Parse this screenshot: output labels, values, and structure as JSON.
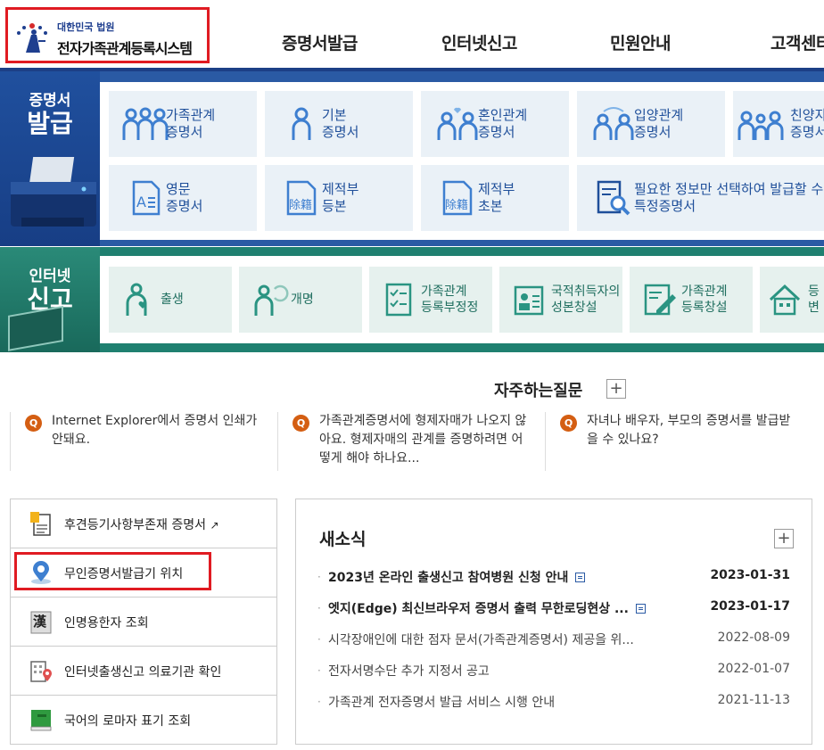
{
  "header": {
    "court": "대한민국 법원",
    "system": "전자가족관계등록시스템",
    "nav": [
      "증명서발급",
      "인터넷신고",
      "민원안내",
      "고객센터"
    ]
  },
  "issue": {
    "side_small": "증명서",
    "side_big": "발급",
    "tiles": [
      {
        "line1": "가족관계",
        "line2": "증명서",
        "icon": "family-icon"
      },
      {
        "line1": "기본",
        "line2": "증명서",
        "icon": "person-icon"
      },
      {
        "line1": "혼인관계",
        "line2": "증명서",
        "icon": "couple-icon"
      },
      {
        "line1": "입양관계",
        "line2": "증명서",
        "icon": "adoption-icon"
      },
      {
        "line1": "친양자",
        "line2": "증명서",
        "icon": "family-icon"
      },
      {
        "line1": "영문",
        "line2": "증명서",
        "icon": "english-document-icon"
      },
      {
        "line1": "제적부",
        "line2": "등본",
        "icon": "register-icon"
      },
      {
        "line1": "제적부",
        "line2": "초본",
        "icon": "register-icon"
      },
      {
        "line1": "필요한 정보만 선택하여 발급할 수",
        "line2": "특정증명서",
        "icon": "magnifier-document-icon"
      }
    ],
    "register_glyph": "除籍"
  },
  "report": {
    "side_small": "인터넷",
    "side_big": "신고",
    "tiles": [
      {
        "line1": "출생",
        "line2": "",
        "icon": "baby-icon"
      },
      {
        "line1": "개명",
        "line2": "",
        "icon": "rename-icon"
      },
      {
        "line1": "가족관계",
        "line2": "등록부정정",
        "icon": "checklist-icon"
      },
      {
        "line1": "국적취득자의",
        "line2": "성본창설",
        "icon": "id-card-icon"
      },
      {
        "line1": "가족관계",
        "line2": "등록창설",
        "icon": "form-pen-icon"
      },
      {
        "line1": "등",
        "line2": "변",
        "icon": "house-icon"
      }
    ]
  },
  "faq": {
    "title": "자주하는질문",
    "more": "+",
    "badge": "Q",
    "items": [
      "Internet Explorer에서 증명서 인쇄가 안돼요.",
      "가족관계증명서에 형제자매가 나오지 않아요. 형제자매의 관계를 증명하려면 어떻게 해야 하나요...",
      "자녀나 배우자, 부모의 증명서를 발급받을 수 있나요?"
    ]
  },
  "quick": {
    "items": [
      {
        "label": "후견등기사항부존재 증명서",
        "icon": "document-icon",
        "external": "↗"
      },
      {
        "label": "무인증명서발급기 위치",
        "icon": "location-pin-icon",
        "external": ""
      },
      {
        "label": "인명용한자 조회",
        "icon": "hanja-book-icon",
        "external": ""
      },
      {
        "label": "인터넷출생신고 의료기관 확인",
        "icon": "hospital-icon",
        "external": ""
      },
      {
        "label": "국어의 로마자 표기 조회",
        "icon": "green-book-icon",
        "external": ""
      }
    ],
    "hanja_glyph": "漢"
  },
  "news": {
    "title": "새소식",
    "more": "+",
    "items": [
      {
        "title": "2023년 온라인 출생신고 참여병원 신청 안내",
        "date": "2023-01-31",
        "bold": true,
        "doc": true
      },
      {
        "title": "엣지(Edge) 최신브라우저 증명서 출력 무한로딩현상 ...",
        "date": "2023-01-17",
        "bold": true,
        "doc": true
      },
      {
        "title": "시각장애인에 대한 점자 문서(가족관계증명서) 제공을 위...",
        "date": "2022-08-09",
        "bold": false,
        "doc": false
      },
      {
        "title": "전자서명수단 추가 지정서 공고",
        "date": "2022-01-07",
        "bold": false,
        "doc": false
      },
      {
        "title": "가족관계 전자증명서 발급 서비스 시행 안내",
        "date": "2021-11-13",
        "bold": false,
        "doc": false
      }
    ]
  },
  "colors": {
    "issue_blue": "#2a5aa4",
    "report_green": "#1f8070",
    "highlight_red": "#e01b22",
    "faq_orange": "#d45e12"
  }
}
